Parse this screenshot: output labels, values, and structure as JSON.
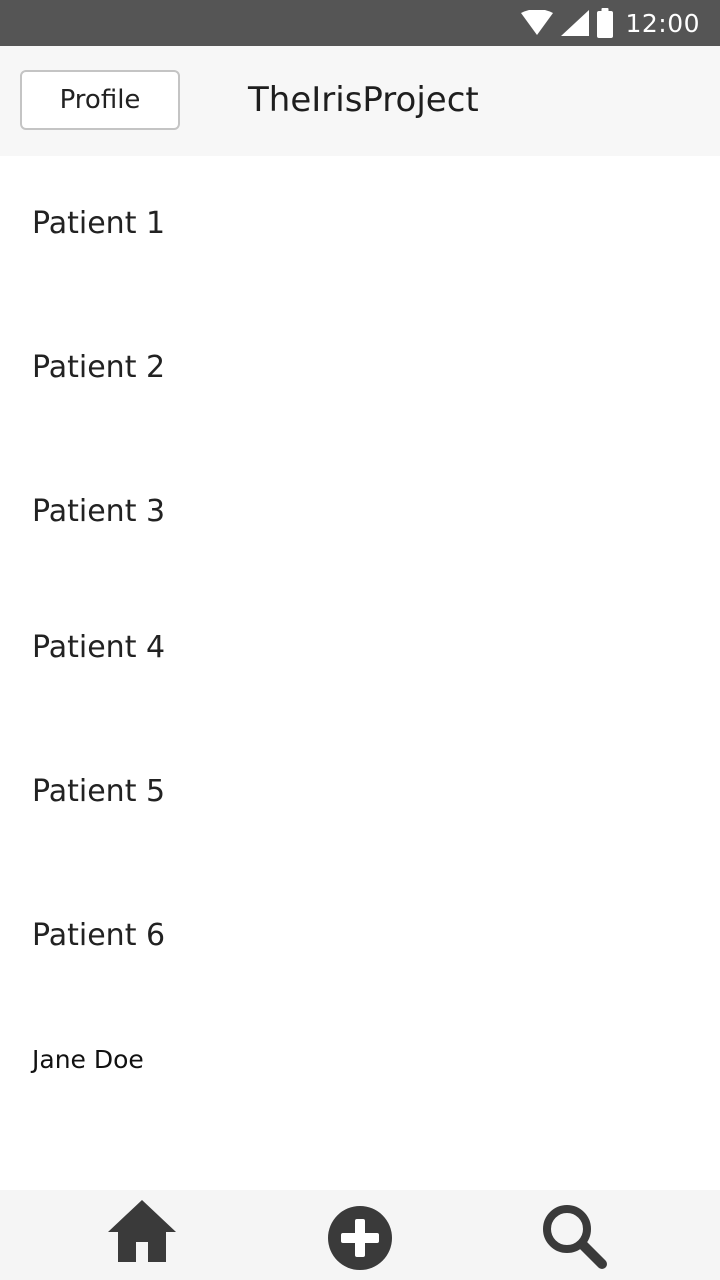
{
  "status_bar": {
    "time": "12:00",
    "icons": [
      "wifi-icon",
      "signal-icon",
      "battery-icon"
    ]
  },
  "app_bar": {
    "profile_label": "Profile",
    "title": "TheIrisProject"
  },
  "patients": [
    {
      "label": "Patient 1"
    },
    {
      "label": "Patient 2"
    },
    {
      "label": "Patient 3"
    },
    {
      "label": "Patient 4"
    },
    {
      "label": "Patient 5"
    },
    {
      "label": "Patient 6"
    },
    {
      "label": "Jane Doe"
    }
  ],
  "bottom_nav": {
    "items": [
      "home-icon",
      "add-circle-icon",
      "search-icon"
    ]
  },
  "colors": {
    "status_bar": "#555555",
    "app_bar": "#f7f7f7",
    "nav_bar": "#f5f5f5",
    "icon": "#3a3a3a"
  }
}
